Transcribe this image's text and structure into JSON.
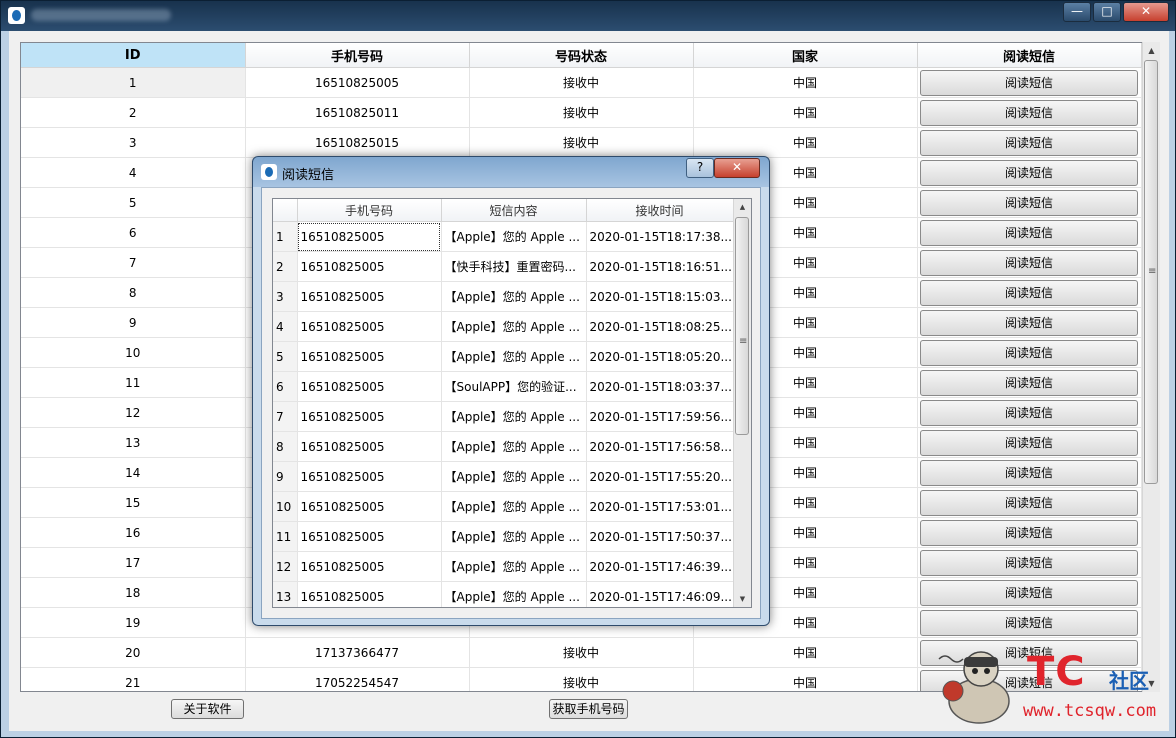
{
  "window": {
    "controls": {
      "minimize": "—",
      "maximize": "□",
      "close": "✕"
    }
  },
  "main_table": {
    "headers": [
      "ID",
      "手机号码",
      "号码状态",
      "国家",
      "阅读短信"
    ],
    "rows": [
      {
        "id": "1",
        "phone": "16510825005",
        "status": "接收中",
        "country": "中国",
        "button": "阅读短信"
      },
      {
        "id": "2",
        "phone": "16510825011",
        "status": "接收中",
        "country": "中国",
        "button": "阅读短信"
      },
      {
        "id": "3",
        "phone": "16510825015",
        "status": "接收中",
        "country": "中国",
        "button": "阅读短信"
      },
      {
        "id": "4",
        "phone": "",
        "status": "",
        "country": "中国",
        "button": "阅读短信"
      },
      {
        "id": "5",
        "phone": "",
        "status": "",
        "country": "中国",
        "button": "阅读短信"
      },
      {
        "id": "6",
        "phone": "",
        "status": "",
        "country": "中国",
        "button": "阅读短信"
      },
      {
        "id": "7",
        "phone": "",
        "status": "",
        "country": "中国",
        "button": "阅读短信"
      },
      {
        "id": "8",
        "phone": "",
        "status": "",
        "country": "中国",
        "button": "阅读短信"
      },
      {
        "id": "9",
        "phone": "",
        "status": "",
        "country": "中国",
        "button": "阅读短信"
      },
      {
        "id": "10",
        "phone": "",
        "status": "",
        "country": "中国",
        "button": "阅读短信"
      },
      {
        "id": "11",
        "phone": "",
        "status": "",
        "country": "中国",
        "button": "阅读短信"
      },
      {
        "id": "12",
        "phone": "",
        "status": "",
        "country": "中国",
        "button": "阅读短信"
      },
      {
        "id": "13",
        "phone": "",
        "status": "",
        "country": "中国",
        "button": "阅读短信"
      },
      {
        "id": "14",
        "phone": "",
        "status": "",
        "country": "中国",
        "button": "阅读短信"
      },
      {
        "id": "15",
        "phone": "",
        "status": "",
        "country": "中国",
        "button": "阅读短信"
      },
      {
        "id": "16",
        "phone": "",
        "status": "",
        "country": "中国",
        "button": "阅读短信"
      },
      {
        "id": "17",
        "phone": "",
        "status": "",
        "country": "中国",
        "button": "阅读短信"
      },
      {
        "id": "18",
        "phone": "",
        "status": "",
        "country": "中国",
        "button": "阅读短信"
      },
      {
        "id": "19",
        "phone": "",
        "status": "",
        "country": "中国",
        "button": "阅读短信"
      },
      {
        "id": "20",
        "phone": "17137366477",
        "status": "接收中",
        "country": "中国",
        "button": "阅读短信"
      },
      {
        "id": "21",
        "phone": "17052254547",
        "status": "接收中",
        "country": "中国",
        "button": "阅读短信"
      }
    ]
  },
  "buttons": {
    "about": "关于软件",
    "get_number": "获取手机号码"
  },
  "dialog": {
    "title": "阅读短信",
    "help": "?",
    "close": "✕",
    "headers": [
      "手机号码",
      "短信内容",
      "接收时间"
    ],
    "rows": [
      {
        "n": "1",
        "phone": "16510825005",
        "content": "【Apple】您的 Apple ...",
        "time": "2020-01-15T18:17:38...."
      },
      {
        "n": "2",
        "phone": "16510825005",
        "content": "【快手科技】重置密码...",
        "time": "2020-01-15T18:16:51...."
      },
      {
        "n": "3",
        "phone": "16510825005",
        "content": "【Apple】您的 Apple ...",
        "time": "2020-01-15T18:15:03...."
      },
      {
        "n": "4",
        "phone": "16510825005",
        "content": "【Apple】您的 Apple ...",
        "time": "2020-01-15T18:08:25...."
      },
      {
        "n": "5",
        "phone": "16510825005",
        "content": "【Apple】您的 Apple ...",
        "time": "2020-01-15T18:05:20...."
      },
      {
        "n": "6",
        "phone": "16510825005",
        "content": "【SoulAPP】您的验证...",
        "time": "2020-01-15T18:03:37...."
      },
      {
        "n": "7",
        "phone": "16510825005",
        "content": "【Apple】您的 Apple ...",
        "time": "2020-01-15T17:59:56...."
      },
      {
        "n": "8",
        "phone": "16510825005",
        "content": "【Apple】您的 Apple ...",
        "time": "2020-01-15T17:56:58...."
      },
      {
        "n": "9",
        "phone": "16510825005",
        "content": "【Apple】您的 Apple ...",
        "time": "2020-01-15T17:55:20...."
      },
      {
        "n": "10",
        "phone": "16510825005",
        "content": "【Apple】您的 Apple ...",
        "time": "2020-01-15T17:53:01...."
      },
      {
        "n": "11",
        "phone": "16510825005",
        "content": "【Apple】您的 Apple ...",
        "time": "2020-01-15T17:50:37...."
      },
      {
        "n": "12",
        "phone": "16510825005",
        "content": "【Apple】您的 Apple ...",
        "time": "2020-01-15T17:46:39...."
      },
      {
        "n": "13",
        "phone": "16510825005",
        "content": "【Apple】您的 Apple ...",
        "time": "2020-01-15T17:46:09...."
      }
    ]
  },
  "watermark": {
    "brand": "TC",
    "brand_cn": "社区",
    "url": "www.tcsqw.com"
  }
}
